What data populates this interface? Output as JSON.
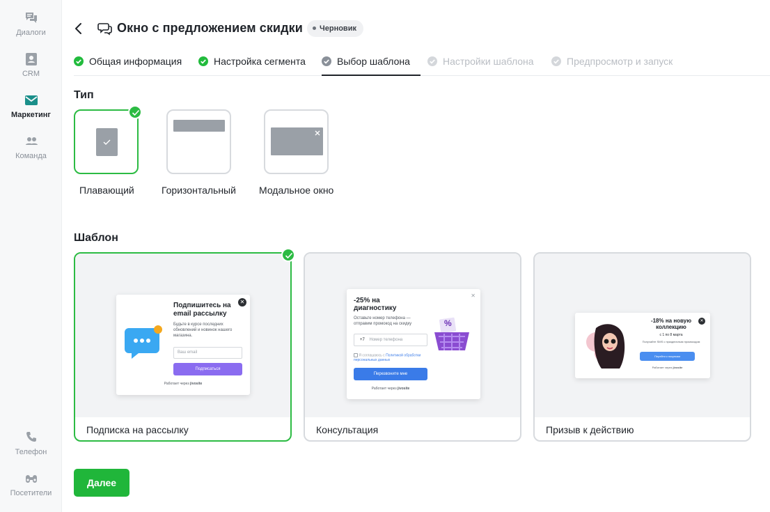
{
  "sidebar": {
    "items": [
      {
        "label": "Диалоги",
        "icon": "chat-icon"
      },
      {
        "label": "CRM",
        "icon": "contact-card-icon"
      },
      {
        "label": "Маркетинг",
        "icon": "envelope-icon",
        "active": true
      },
      {
        "label": "Команда",
        "icon": "team-icon"
      }
    ],
    "bottom": [
      {
        "label": "Телефон",
        "icon": "phone-icon"
      },
      {
        "label": "Посетители",
        "icon": "binoculars-icon"
      }
    ]
  },
  "header": {
    "title": "Окно с предложением скидки",
    "status": "Черновик"
  },
  "steps": [
    {
      "label": "Общая информация",
      "state": "done"
    },
    {
      "label": "Настройка сегмента",
      "state": "done"
    },
    {
      "label": "Выбор шаблона",
      "state": "current"
    },
    {
      "label": "Настройки шаблона",
      "state": "todo"
    },
    {
      "label": "Предпросмотр и запуск",
      "state": "todo"
    }
  ],
  "type_section": {
    "heading": "Тип",
    "options": [
      {
        "label": "Плавающий",
        "selected": true
      },
      {
        "label": "Горизонтальный",
        "selected": false
      },
      {
        "label": "Модальное окно",
        "selected": false
      }
    ]
  },
  "template_section": {
    "heading": "Шаблон",
    "templates": [
      {
        "label": "Подписка на рассылку",
        "selected": true,
        "preview": {
          "title": "Подпишитесь на email рассылку",
          "text": "Будьте в курсе последних обновлений и новинок нашего магазина.",
          "input_placeholder": "Ваш email",
          "button": "Подписаться",
          "footer": "Работает через",
          "brand": "jivosite"
        }
      },
      {
        "label": "Консультация",
        "selected": false,
        "preview": {
          "title": "-25% на диагностику",
          "text": "Оставьте номер телефона — отправим промокод на скидку",
          "phone_prefix": "+7",
          "input_placeholder": "Номер телефона",
          "consent_prefix": "Я соглашаюсь с ",
          "consent_link": "Политикой обработки персональных данных",
          "button": "Перезвоните мне",
          "footer": "Работает через",
          "brand": "jivosite",
          "badge": "%"
        }
      },
      {
        "label": "Призыв к действию",
        "selected": false,
        "preview": {
          "title": "-18% на новую коллекцию",
          "subtitle": "с 1 по 8 марта",
          "text": "Получайте SMS с праздничным промокодом",
          "button": "Перейти к покупкам",
          "footer": "Работает через",
          "brand": "jivosite"
        }
      }
    ]
  },
  "actions": {
    "next": "Далее"
  },
  "colors": {
    "accent_green": "#20b63a",
    "sidebar_active": "#1a8f8a",
    "purple_button": "#8a6cf0",
    "blue_button": "#3a7be8"
  }
}
